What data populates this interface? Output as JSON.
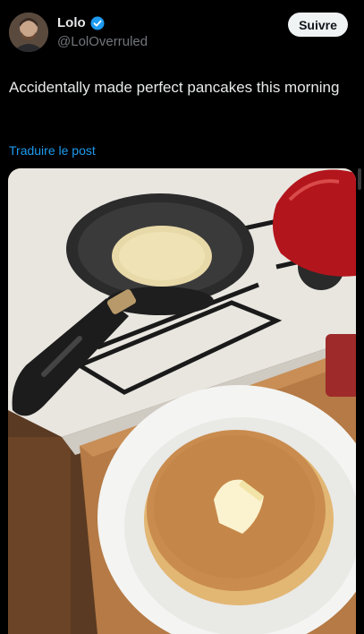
{
  "author": {
    "display_name": "Lolo",
    "handle": "@LolOverruled",
    "verified": true,
    "avatar_icon": "user-avatar"
  },
  "follow_button": {
    "label": "Suivre"
  },
  "post": {
    "text": "Accidentally made perfect pancakes this morning",
    "translate_label": "Traduire le post"
  },
  "colors": {
    "background": "#000000",
    "text": "#e7e9ea",
    "muted": "#71767b",
    "link": "#1d9bf0",
    "verified_badge": "#1d9bf0"
  }
}
